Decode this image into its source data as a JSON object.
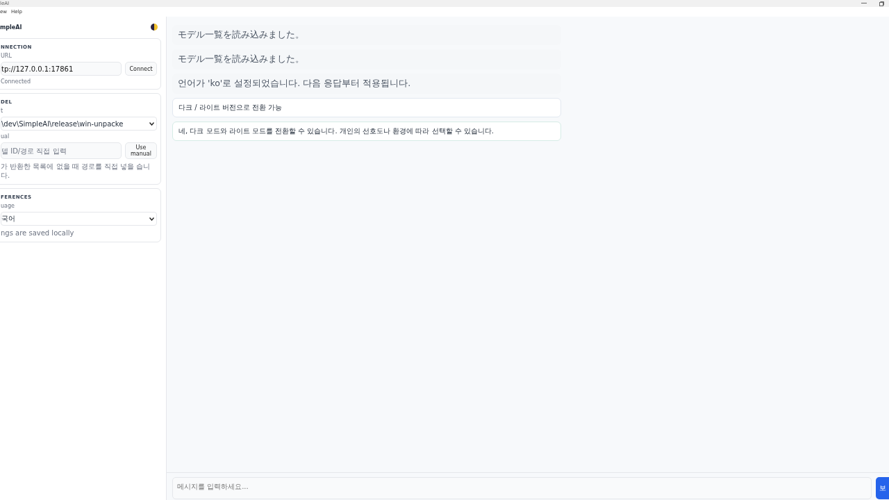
{
  "window": {
    "title": "leAI"
  },
  "menu": [
    "ew",
    "Help"
  ],
  "sidebar": {
    "app_name": "mpleAI",
    "connection": {
      "heading": "NNECTION",
      "url_label": "URL",
      "url_value": "tp://127.0.0.1:17861",
      "button": "Connect",
      "status": "Connected"
    },
    "model": {
      "heading": "DEL",
      "select_label": "t",
      "select_value": "\\dev\\SimpleAI\\release\\win-unpacke",
      "manual_label": "ual",
      "manual_placeholder": "델 ID/경로 직접 입력",
      "manual_button": "Use manual",
      "hint": "가 반환한 목록에 없을 때 경로를 직접 넣을 습니다."
    },
    "preferences": {
      "heading": "FERENCES",
      "language_label": "uage",
      "language_value": "국어",
      "note": "ngs are saved locally"
    }
  },
  "messages": [
    {
      "kind": "system",
      "text": "モデル一覧を読み込みました。"
    },
    {
      "kind": "system",
      "text": "モデル一覧を読み込みました。"
    },
    {
      "kind": "system",
      "text": "언어가 'ko'로 설정되었습니다. 다음 응답부터 적용됩니다."
    },
    {
      "kind": "user",
      "text": "다크 / 라이트 버전으로 전환 가능"
    },
    {
      "kind": "assistant",
      "text": "네, 다크 모드와 라이트 모드를 전환할 수 있습니다. 개인의 선호도나 환경에 따라 선택할 수 있습니다."
    }
  ],
  "composer": {
    "placeholder": "메시지를 입력하세요...",
    "send": "보"
  }
}
